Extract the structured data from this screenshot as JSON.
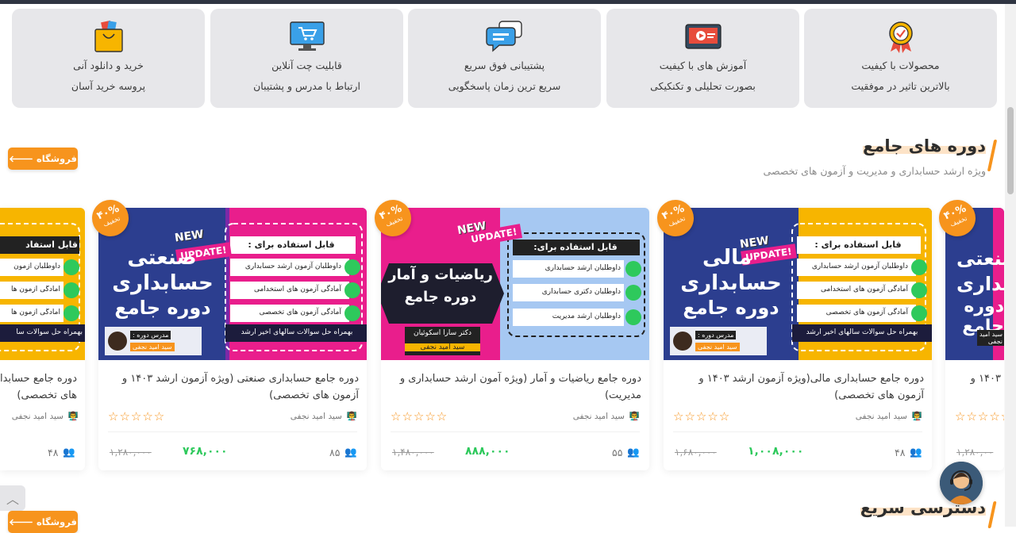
{
  "features": [
    {
      "title": "محصولات با کیفیت",
      "subtitle": "بالاترین تاثیر در موفقیت",
      "icon": "quality-badge-icon"
    },
    {
      "title": "آموزش های با کیفیت",
      "subtitle": "بصورت تحلیلی و تکنکیکی",
      "icon": "video-tutorial-icon"
    },
    {
      "title": "پشتیبانی فوق سریع",
      "subtitle": "سریع ترین زمان پاسخگویی",
      "icon": "chat-support-icon"
    },
    {
      "title": "قابلیت چت آنلاین",
      "subtitle": "ارتباط با مدرس و پشتیبان",
      "icon": "monitor-cart-icon"
    },
    {
      "title": "خرید و دانلود آنی",
      "subtitle": "پروسه خرید آسان",
      "icon": "shopping-bag-icon"
    }
  ],
  "section": {
    "title": "دوره های جامع",
    "subtitle": "ویژه ارشد حسابداری و مدیریت و آزمون های تخصصی",
    "shop_label": "فروشگاه"
  },
  "section2": {
    "title": "دسترسی سریع",
    "shop_label": "فروشگاه"
  },
  "cards": [
    {
      "title": "دوره جامع حسابداری مالی(ویژه آزمون ارشد ۱۴۰۳ و آزمون های تخصصی)",
      "teacher": "سید امید نجفی",
      "students": "۴۸",
      "price": "۱,۰۰۸,۰۰۰",
      "old_price": "۱,۶۸۰,۰۰۰",
      "discount": "۴۰%",
      "discount_label": "تخفیف",
      "rating": 0,
      "banner": {
        "line1": "مالی",
        "line2": "حسابداری",
        "line3": "دوره جامع",
        "bg": "#2c3e8f",
        "accent": "#f7b500",
        "use_title": "قابل استفاده برای :",
        "items": [
          "داوطلبان آزمون ارشد حسابداری",
          "آمادگی آزمون های استخدامی",
          "آمادگی آزمون های تخصصی"
        ],
        "footer": "بهمراه حل سوالات سالهای اخیر ارشد",
        "new": "NEW",
        "update": "UPDATE!",
        "teacher_tag": "مدرس دوره :",
        "teacher_name": "سید امید نجفی"
      }
    },
    {
      "title": "دوره جامع ریاضیات و آمار (ویژه آمون ارشد حسابداری و مدیریت)",
      "teacher": "سید امید نجفی",
      "students": "۵۵",
      "price": "۸۸۸,۰۰۰",
      "old_price": "۱,۴۸۰,۰۰۰",
      "discount": "۴۰%",
      "discount_label": "تخفیف",
      "rating": 0,
      "banner": {
        "line1": "ریاضیات و آمار",
        "line2": "",
        "line3": "دوره جامع",
        "bg": "#e91e8c",
        "accent": "#a6c8f2",
        "use_title": "قابل استفاده برای:",
        "items": [
          "داوطلبان ارشد حسابداری",
          "داوطلبان دکتری حسابداری",
          "داوطلبان ارشد مدیریت"
        ],
        "footer": "",
        "new": "NEW",
        "update": "UPDATE!",
        "teacher_tag": "دکتر سارا اسکوئیان",
        "teacher_name": "سید امید نجفی"
      }
    },
    {
      "title": "دوره جامع حسابداری صنعتی (ویژه آزمون ارشد ۱۴۰۳ و آزمون های تخصصی)",
      "teacher": "سید امید نجفی",
      "students": "۸۵",
      "price": "۷۶۸,۰۰۰",
      "old_price": "۱,۲۸۰,۰۰۰",
      "discount": "۴۰%",
      "discount_label": "تخفیف",
      "rating": 0,
      "banner": {
        "line1": "صنعتی",
        "line2": "حسابداری",
        "line3": "دوره جامع",
        "bg": "#2c3e8f",
        "accent": "#e91e8c",
        "use_title": "قابل استفاده برای :",
        "items": [
          "داوطلبان آزمون ارشد حسابداری",
          "آمادگی آزمون های استخدامی",
          "آمادگی آزمون های تخصصی"
        ],
        "footer": "بهمراه حل سوالات سالهای اخیر ارشد",
        "new": "NEW",
        "update": "UPDATE!",
        "teacher_tag": "مدرس دوره :",
        "teacher_name": "سید امید نجفی"
      }
    }
  ],
  "partial_right": {
    "discount": "۴۰%",
    "discount_label": "تخفیف",
    "line1": "صنعتی",
    "line2": "حسابداری",
    "line3": "دوره جامع",
    "title": "۱۴۰۳ و",
    "old_price": "۱,۲۸۰,۰۰",
    "teacher_name": "سید امید نجفی"
  },
  "partial_left": {
    "title_l1": "دوره جامع حسابدا",
    "title_l2": "های تخصصی)",
    "teacher": "سید امید نجفی",
    "students": "۴۸",
    "use_title": "قابل استفاد",
    "items": [
      "داوطلبان آزمون",
      "آمادگی آزمون ها",
      "آمادگی آزمون ها"
    ],
    "footer": "بهمراه حل سوالات سا"
  },
  "colors": {
    "accent": "#f7941d",
    "price": "#2ec95c",
    "feature_bg": "#e7e7ea"
  }
}
